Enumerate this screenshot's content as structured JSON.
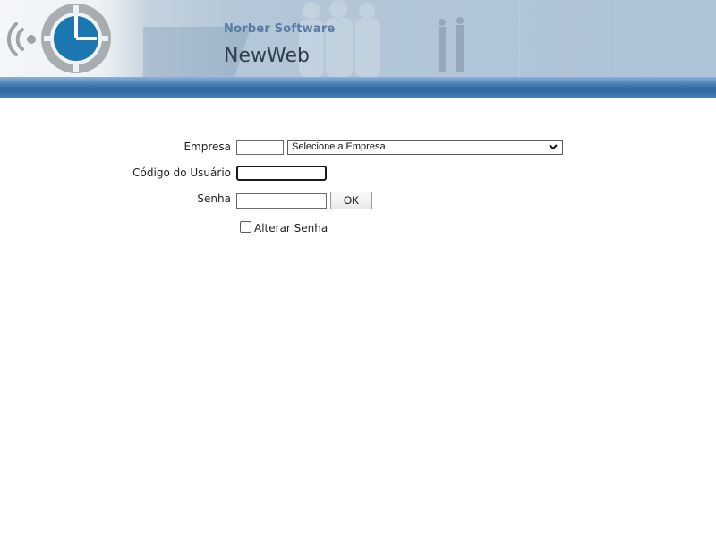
{
  "header": {
    "company": "Norber Software",
    "app_name": "NewWeb",
    "logo_icon": "clock-wifi-logo",
    "colors": {
      "header_bg": "#aec3d6",
      "banner": "#3a6ea8",
      "company_text": "#5a7aa3",
      "logo_blue": "#1a77b0",
      "logo_gray": "#9ea3a8"
    }
  },
  "login_form": {
    "empresa": {
      "label": "Empresa",
      "code_value": "",
      "select": {
        "selected": "Selecione a Empresa"
      }
    },
    "usuario": {
      "label": "Código do Usuário",
      "value": ""
    },
    "senha": {
      "label": "Senha",
      "value": ""
    },
    "ok_button": "OK",
    "alterar_senha": {
      "label": "Alterar Senha",
      "checked": false
    }
  }
}
